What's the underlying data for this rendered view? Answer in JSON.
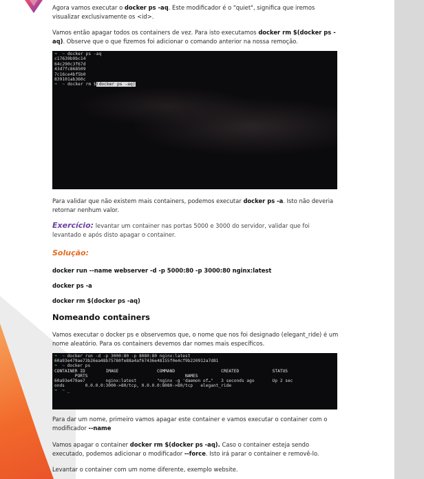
{
  "brand": {
    "logo_icon": "gradient-triangle-logo",
    "colors": {
      "orange": "#f26a2b",
      "purple": "#6a3fa0",
      "grey_panel": "#d9d9d9"
    }
  },
  "p1": {
    "pre": "Agora vamos executar o ",
    "cmd": "docker ps -aq",
    "post": ". Este modificador é o \"quiet\", significa que iremos visualizar exclusivamente os <id>."
  },
  "p2": {
    "pre": "Vamos então apagar todos os containers de vez. Para isto executamos ",
    "cmd": "docker rm $(docker ps -aq)",
    "post": ". Observe que o que fizemos foi adicionar o comando anterior na nossa remoção."
  },
  "terminal1": {
    "prompt_arrow": "➜",
    "prompt_dir": "~",
    "cmd1": "docker ps -aq",
    "ids": [
      "c17639b9bc14",
      "64c290c3f67d",
      "43d7fc868509",
      "7c16ce4bf5b0",
      "839101ab360c"
    ],
    "cmd2_pre": "docker rm $",
    "cmd2_sel": "(docker ps -aq)"
  },
  "p3": {
    "pre": "Para validar que não existem mais containers, podemos executar ",
    "cmd": "docker ps -a",
    "post": ". Isto não deveria retornar nenhum valor."
  },
  "exercicio": {
    "label": "Exercício:",
    "text": " levantar um container nas portas 5000 e 3000 do servidor, validar que foi levantado e após disto apagar o container."
  },
  "solucao": {
    "label": "Solução:"
  },
  "cmds": [
    "docker run --name webserver -d -p 5000:80 -p 3000:80 nginx:latest",
    "docker ps -a",
    "docker rm $(docker ps -aq)"
  ],
  "section_title": "Nomeando containers",
  "p4": "Vamos executar o docker ps e observemos que, o nome que nos foi designado (elegant_ride) é um nome aleatório. Para os containers devemos dar nomes mais específicos.",
  "terminal2": {
    "line1": "docker run -d -p 3000:80 -p 8080:80 nginx:latest",
    "line2": "60a93e479ae73b26ea48b75780fe88a4af67436e48155f0e4cf9b220912a7d81",
    "line3": "docker ps",
    "header1": "CONTAINER ID        IMAGE               COMMAND                  CREATED             STATUS",
    "header2": "        PORTS                                      NAMES",
    "row1": "60a93e479ae7        nginx:latest        \"nginx -g 'daemon of…\"   3 seconds ago       Up 2 sec",
    "row2": "onds        0.0.0.0:3000->80/tcp, 0.0.0.0:8080->80/tcp   elegant_ride",
    "last_prompt": "_"
  },
  "p5": {
    "pre": "Para dar um nome, primeiro vamos apagar este container e vamos executar o container com o modificador  ",
    "cmd": "--name"
  },
  "p6": {
    "pre": "Vamos apagar o container ",
    "cmd": "docker rm $(docker ps -aq).",
    "mid": " Caso o container esteja sendo executado, podemos adicionar o modificador ",
    "cmd2": "--force",
    "post": ". Isto irá parar o container e removê-lo."
  },
  "p7": "Levantar o container com um nome diferente, exemplo website."
}
